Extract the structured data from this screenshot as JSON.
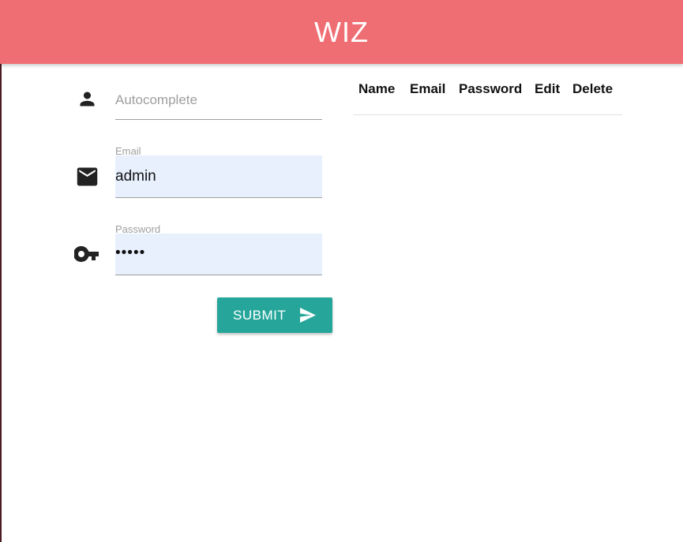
{
  "app": {
    "brand": "WIZ",
    "navbar_color": "#ef6e73"
  },
  "form": {
    "name_field": {
      "placeholder": "Autocomplete",
      "icon": "person-icon"
    },
    "email_field": {
      "label": "Email",
      "value": "admin",
      "icon": "email-icon"
    },
    "password_field": {
      "label": "Password",
      "value": "•••••",
      "icon": "key-icon"
    },
    "submit": {
      "label": "SUBMIT",
      "icon": "send-icon",
      "color": "#26a69a"
    }
  },
  "table": {
    "columns": [
      "Name",
      "Email",
      "Password",
      "Edit",
      "Delete"
    ],
    "rows": []
  }
}
